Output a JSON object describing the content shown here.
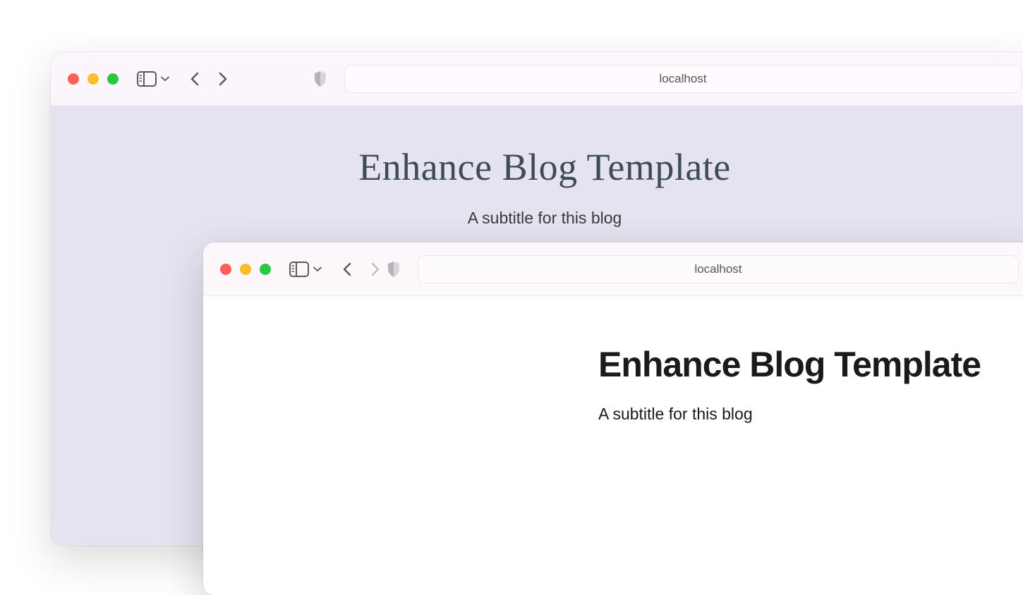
{
  "window1": {
    "address": "localhost",
    "title": "Enhance Blog Template",
    "subtitle": "A subtitle for this blog"
  },
  "window2": {
    "address": "localhost",
    "title": "Enhance Blog Template",
    "subtitle": "A subtitle for this blog"
  }
}
